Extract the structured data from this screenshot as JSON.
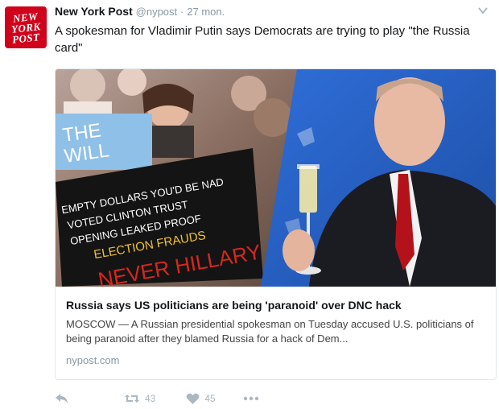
{
  "account": {
    "avatar_text": [
      "NEW",
      "YORK",
      "POST"
    ],
    "name": "New York Post",
    "handle": "@nypost",
    "time": "27 mon."
  },
  "tweet": {
    "text": "A spokesman for Vladimir Putin says Democrats are trying to play \"the Russia card\""
  },
  "card": {
    "image_left": {
      "sign_lines": [
        "THE",
        "WILL"
      ],
      "placard_lines": [
        "EMPTY DOLLARS YOU'D BE NAD",
        "VOTED CLINTON TRUST",
        "OPENING LEAKED PROOF",
        "ELECTION FRAUDS",
        "NEVER HILLARY"
      ]
    },
    "title": "Russia says US politicians are being 'paranoid' over DNC hack",
    "description": "MOSCOW — A Russian presidential spokesman on Tuesday accused U.S. politicians of being paranoid after they blamed Russia for a hack of Dem...",
    "domain": "nypost.com"
  },
  "actions": {
    "reply_icon": "reply-icon",
    "retweet_icon": "retweet-icon",
    "retweets": "43",
    "like_icon": "heart-icon",
    "likes": "45",
    "more_icon": "more-icon"
  },
  "colors": {
    "brand_red": "#d0021b",
    "muted": "#aab8c2",
    "border": "#e1e8ed",
    "photo_blue": "#2c66c9"
  }
}
